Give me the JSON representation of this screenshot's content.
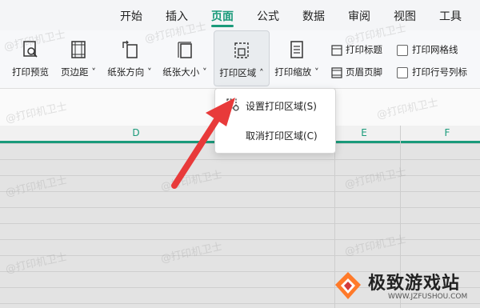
{
  "menubar": {
    "tabs": [
      {
        "label": "开始"
      },
      {
        "label": "插入"
      },
      {
        "label": "页面",
        "active": true
      },
      {
        "label": "公式"
      },
      {
        "label": "数据"
      },
      {
        "label": "审阅"
      },
      {
        "label": "视图"
      },
      {
        "label": "工具"
      }
    ]
  },
  "ribbon": {
    "print_preview": "打印预览",
    "margins": "页边距",
    "orientation": "纸张方向",
    "paper_size": "纸张大小",
    "print_area": "打印区域",
    "print_scale": "打印缩放",
    "print_titles": "打印标题",
    "header_footer": "页眉页脚",
    "print_gridlines": "打印网格线",
    "print_row_col_headers": "打印行号列标"
  },
  "columns": {
    "d": "D",
    "e": "E",
    "f": "F"
  },
  "dropdown": {
    "set_print_area": "设置打印区域(S)",
    "clear_print_area": "取消打印区域(C)"
  },
  "watermark": "@打印机卫士",
  "logo": {
    "name": "极致游戏站",
    "url": "WWW.JZFUSHOU.COM"
  },
  "colors": {
    "accent": "#1a9a7a",
    "arrow": "#e83a3a"
  }
}
